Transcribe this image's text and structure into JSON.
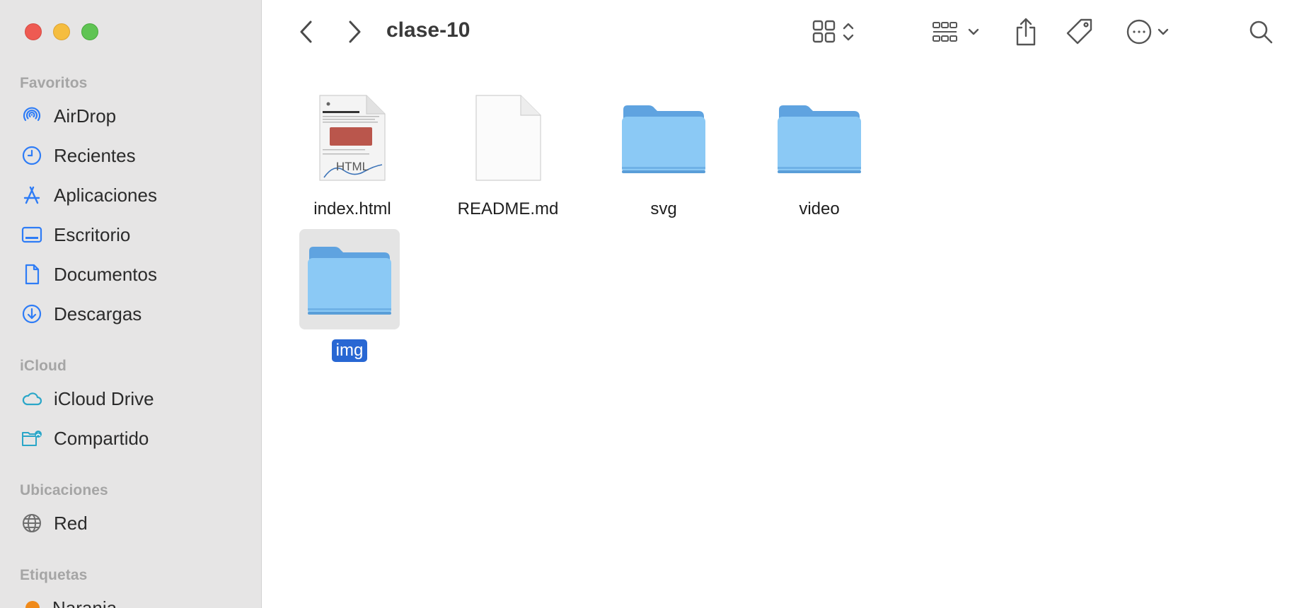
{
  "window": {
    "title": "clase-10"
  },
  "sidebar": {
    "sections": [
      {
        "title": "Favoritos",
        "items": [
          {
            "label": "AirDrop",
            "icon": "airdrop-icon"
          },
          {
            "label": "Recientes",
            "icon": "clock-icon"
          },
          {
            "label": "Aplicaciones",
            "icon": "applications-icon"
          },
          {
            "label": "Escritorio",
            "icon": "desktop-icon"
          },
          {
            "label": "Documentos",
            "icon": "document-icon"
          },
          {
            "label": "Descargas",
            "icon": "download-icon"
          }
        ]
      },
      {
        "title": "iCloud",
        "items": [
          {
            "label": "iCloud Drive",
            "icon": "cloud-icon"
          },
          {
            "label": "Compartido",
            "icon": "shared-folder-icon"
          }
        ]
      },
      {
        "title": "Ubicaciones",
        "items": [
          {
            "label": "Red",
            "icon": "network-globe-icon"
          }
        ]
      },
      {
        "title": "Etiquetas",
        "items": [
          {
            "label": "Naranja",
            "icon": "orange-tag-dot",
            "color": "#f08a1a"
          }
        ]
      }
    ]
  },
  "toolbar": {
    "icons": [
      "back-icon",
      "forward-icon",
      "icon-view-icon",
      "group-icon",
      "share-icon",
      "tag-icon",
      "more-icon",
      "search-icon"
    ]
  },
  "files": [
    {
      "name": "index.html",
      "kind": "html-document",
      "selected": false,
      "preview_text": "HTML"
    },
    {
      "name": "README.md",
      "kind": "blank-document",
      "selected": false
    },
    {
      "name": "svg",
      "kind": "folder",
      "selected": false
    },
    {
      "name": "video",
      "kind": "folder",
      "selected": false
    },
    {
      "name": "img",
      "kind": "folder",
      "selected": true
    }
  ],
  "colors": {
    "sidebar_bg": "#e6e5e5",
    "accent": "#2867d3",
    "folder_blue": "#8bc9f5",
    "sidebar_icon": "#2e7cf6"
  }
}
